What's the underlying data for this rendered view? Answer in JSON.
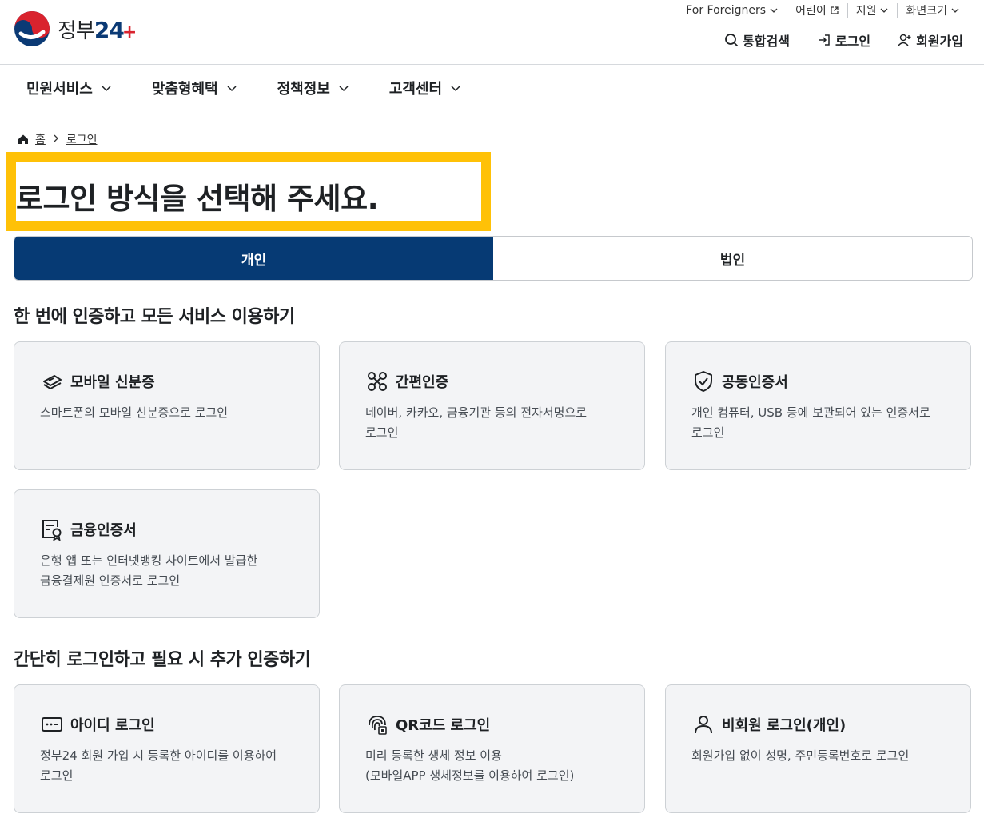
{
  "header": {
    "logo": {
      "text_main": "정부",
      "text_num": "24",
      "text_plus": "+"
    },
    "util": [
      {
        "label": "For Foreigners",
        "icon": "chevron-down-icon"
      },
      {
        "label": "어린이",
        "icon": "external-link-icon"
      },
      {
        "label": "지원",
        "icon": "chevron-down-icon"
      },
      {
        "label": "화면크기",
        "icon": "chevron-down-icon"
      }
    ],
    "actions": {
      "search": "통합검색",
      "login": "로그인",
      "signup": "회원가입"
    }
  },
  "gnb": {
    "items": [
      {
        "label": "민원서비스"
      },
      {
        "label": "맞춤형혜택"
      },
      {
        "label": "정책정보"
      },
      {
        "label": "고객센터"
      }
    ]
  },
  "breadcrumb": {
    "home": "홈",
    "current": "로그인"
  },
  "page": {
    "title": "로그인 방식을 선택해 주세요."
  },
  "tabs": [
    {
      "label": "개인",
      "active": true
    },
    {
      "label": "법인",
      "active": false
    }
  ],
  "section1": {
    "title": "한 번에 인증하고 모든 서비스 이용하기",
    "cards": [
      {
        "title": "모바일 신분증",
        "desc": "스마트폰의 모바일 신분증으로 로그인",
        "icon": "mobile-id-icon"
      },
      {
        "title": "간편인증",
        "desc": "네이버, 카카오, 금융기관 등의 전자서명으로\n로그인",
        "icon": "simple-auth-icon"
      },
      {
        "title": "공동인증서",
        "desc": "개인 컴퓨터, USB 등에 보관되어 있는 인증서로\n로그인",
        "icon": "shield-check-icon"
      },
      {
        "title": "금융인증서",
        "desc": "은행 앱 또는 인터넷뱅킹 사이트에서 발급한\n금융결제원 인증서로 로그인",
        "icon": "certificate-icon"
      }
    ]
  },
  "section2": {
    "title": "간단히 로그인하고 필요 시 추가 인증하기",
    "cards": [
      {
        "title": "아이디 로그인",
        "desc": "정부24 회원 가입 시 등록한 아이디를 이용하여\n로그인",
        "icon": "id-card-icon"
      },
      {
        "title": "QR코드 로그인",
        "desc": "미리 등록한 생체 정보 이용\n(모바일APP 생체정보를 이용하여 로그인)",
        "icon": "fingerprint-qr-icon"
      },
      {
        "title": "비회원 로그인(개인)",
        "desc": "회원가입 없이 성명, 주민등록번호로 로그인",
        "icon": "user-icon"
      }
    ]
  },
  "colors": {
    "primary": "#063a74",
    "highlight": "#ffc107",
    "card_bg": "#f3f4f6"
  }
}
